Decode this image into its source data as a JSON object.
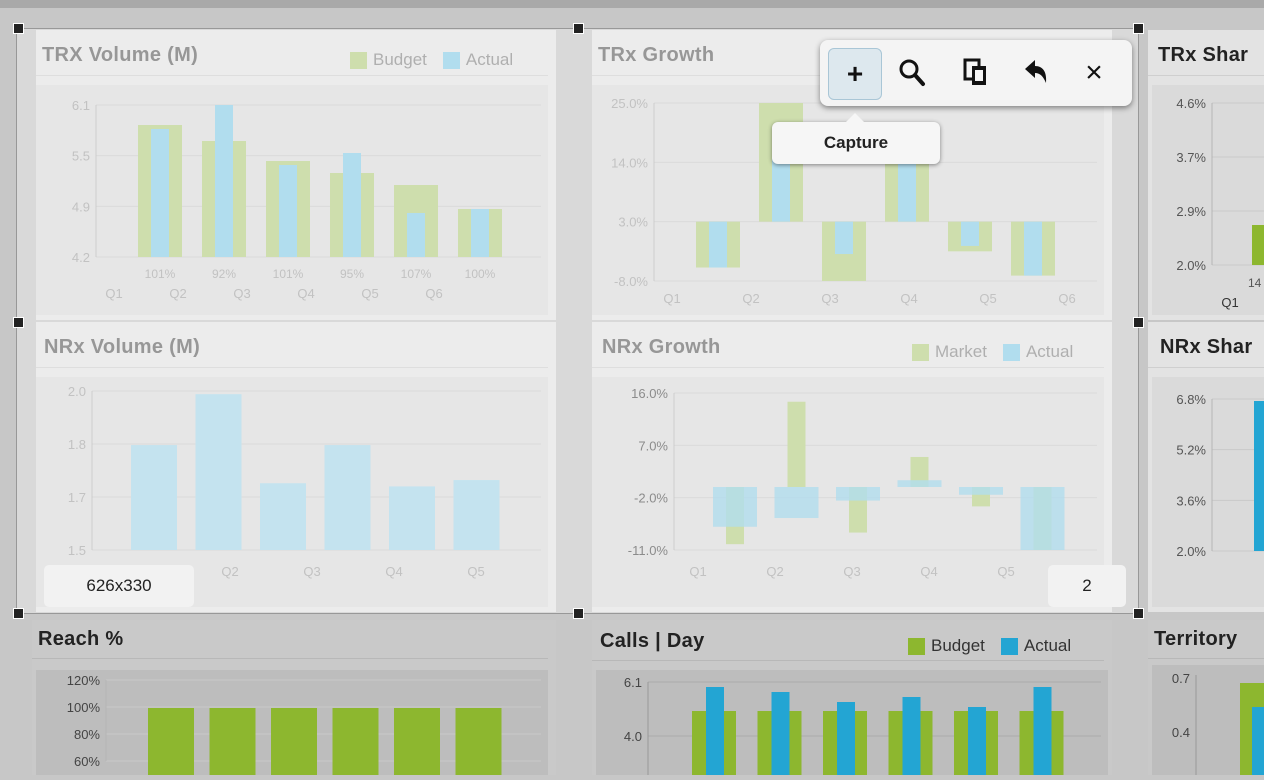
{
  "colors": {
    "budget_green": "#8db72f",
    "actual_blue": "#23a5d3",
    "plot_bg": "#dadada",
    "panel_bg": "#e3e3e3"
  },
  "panels": {
    "trx_volume": {
      "title": "TRX Volume (M)",
      "legend": [
        {
          "label": "Budget",
          "color": "#8db72f"
        },
        {
          "label": "Actual",
          "color": "#23a5d3"
        }
      ],
      "chart_data": {
        "type": "bar",
        "title": "TRX Volume (M)",
        "categories": [
          "Q1",
          "Q2",
          "Q3",
          "Q4",
          "Q5",
          "Q6"
        ],
        "yticks": [
          "6.1",
          "5.5",
          "4.9",
          "4.2"
        ],
        "ylim": [
          4.2,
          6.1
        ],
        "series": [
          {
            "name": "Budget",
            "values": [
              5.85,
              5.65,
              5.4,
              5.25,
              5.1,
              4.8
            ]
          },
          {
            "name": "Actual",
            "values": [
              5.8,
              6.1,
              5.35,
              5.5,
              4.75,
              4.8
            ]
          }
        ],
        "data_labels": [
          "101%",
          "92%",
          "101%",
          "95%",
          "107%",
          "100%"
        ]
      }
    },
    "trx_growth": {
      "title": "TRx Growth",
      "chart_data": {
        "type": "bar",
        "title": "TRx Growth",
        "categories": [
          "Q1",
          "Q2",
          "Q3",
          "Q4",
          "Q5",
          "Q6"
        ],
        "yticks": [
          "25.0%",
          "14.0%",
          "3.0%",
          "-8.0%"
        ],
        "ylim": [
          -8,
          25
        ],
        "series": [
          {
            "name": "Budget",
            "values": [
              -5.5,
              25,
              -8,
              16,
              -2.5,
              -7
            ]
          },
          {
            "name": "Actual",
            "values": [
              -5.5,
              15,
              -3,
              15,
              -1.5,
              -7
            ]
          }
        ]
      }
    },
    "trx_share": {
      "title": "TRx Shar",
      "chart_data": {
        "type": "bar",
        "yticks": [
          "4.6%",
          "3.7%",
          "2.9%",
          "2.0%"
        ],
        "categories": [
          "Q1"
        ],
        "data_labels": [
          "14"
        ]
      }
    },
    "nrx_volume": {
      "title": "NRx Volume (M)",
      "chart_data": {
        "type": "bar",
        "title": "NRx Volume (M)",
        "categories": [
          "Q1",
          "Q2",
          "Q3",
          "Q4",
          "Q5"
        ],
        "yticks": [
          "2.0",
          "1.8",
          "1.7",
          "1.5"
        ],
        "ylim": [
          1.5,
          2.0
        ],
        "series": [
          {
            "name": "Actual",
            "values": [
              1.83,
              1.99,
              1.71,
              1.83,
              1.7,
              1.72
            ]
          }
        ]
      }
    },
    "nrx_growth": {
      "title": "NRx Growth",
      "legend": [
        {
          "label": "Market",
          "color": "#8db72f"
        },
        {
          "label": "Actual",
          "color": "#23a5d3"
        }
      ],
      "chart_data": {
        "type": "bar",
        "title": "NRx Growth",
        "categories": [
          "Q1",
          "Q2",
          "Q3",
          "Q4",
          "Q5",
          "Q6"
        ],
        "yticks": [
          "16.0%",
          "7.0%",
          "-2.0%",
          "-11.0%"
        ],
        "ylim": [
          -11,
          16
        ],
        "series": [
          {
            "name": "Market",
            "values": [
              -10,
              14.5,
              -8,
              5,
              -3.5,
              -11
            ]
          },
          {
            "name": "Actual",
            "values": [
              -7,
              -5.5,
              -2.5,
              1,
              -1.5,
              -11
            ]
          }
        ]
      }
    },
    "nrx_share": {
      "title": "NRx Shar",
      "chart_data": {
        "type": "bar",
        "yticks": [
          "6.8%",
          "5.2%",
          "3.6%",
          "2.0%"
        ]
      }
    },
    "reach": {
      "title": "Reach %",
      "chart_data": {
        "type": "bar",
        "title": "Reach %",
        "yticks": [
          "120%",
          "100%",
          "80%",
          "60%"
        ],
        "ylim": [
          50,
          120
        ],
        "series": [
          {
            "name": "Budget",
            "values": [
              100,
              100,
              100,
              100,
              100,
              100
            ]
          }
        ]
      }
    },
    "calls_day": {
      "title": "Calls | Day",
      "legend": [
        {
          "label": "Budget",
          "color": "#8db72f"
        },
        {
          "label": "Actual",
          "color": "#23a5d3"
        }
      ],
      "chart_data": {
        "type": "bar",
        "title": "Calls | Day",
        "yticks": [
          "6.1",
          "4.0"
        ],
        "ylim": [
          0,
          6.1
        ],
        "series": [
          {
            "name": "Budget",
            "values": [
              4.6,
              4.6,
              4.6,
              4.6,
              4.6,
              4.6
            ]
          },
          {
            "name": "Actual",
            "values": [
              6.0,
              5.9,
              5.7,
              5.8,
              5.6,
              6.0
            ]
          }
        ]
      }
    },
    "territory": {
      "title": "Territory",
      "chart_data": {
        "type": "bar",
        "yticks": [
          "0.7",
          "0.4"
        ]
      }
    }
  },
  "toolbar": {
    "buttons": [
      {
        "name": "capture",
        "glyph": "+",
        "active": true
      },
      {
        "name": "zoom",
        "glyph": "search"
      },
      {
        "name": "copy",
        "glyph": "copy"
      },
      {
        "name": "undo",
        "glyph": "undo"
      },
      {
        "name": "close",
        "glyph": "×"
      }
    ],
    "tooltip": "Capture"
  },
  "selection": {
    "size_label": "626x330",
    "page_label": "2"
  }
}
